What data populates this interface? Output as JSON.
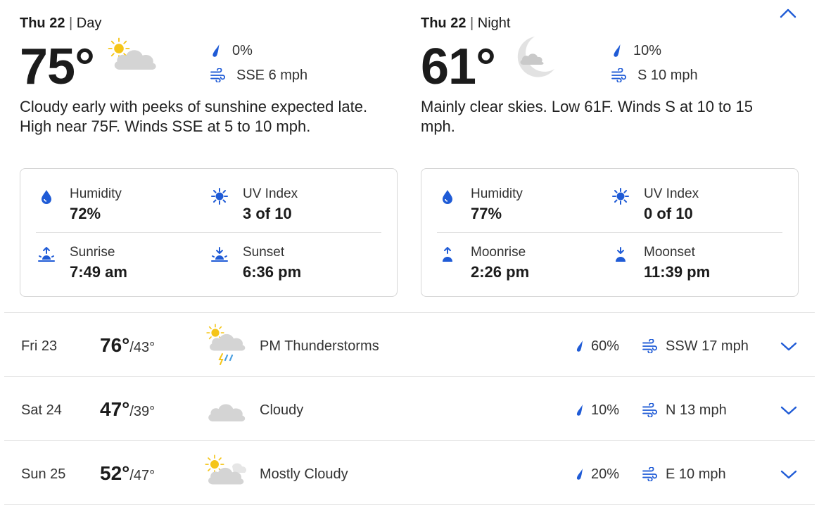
{
  "day": {
    "date": "Thu 22",
    "period": "Day",
    "temp": "75°",
    "precip": "0%",
    "wind": "SSE 6 mph",
    "description": "Cloudy early with peeks of sunshine expected late. High near 75F. Winds SSE at 5 to 10 mph.",
    "icon": "partly-cloudy-day-icon",
    "details": [
      {
        "label": "Humidity",
        "value": "72%",
        "icon": "humidity-drop-icon"
      },
      {
        "label": "UV Index",
        "value": "3 of 10",
        "icon": "uv-sun-icon"
      },
      {
        "label": "Sunrise",
        "value": "7:49 am",
        "icon": "sunrise-icon"
      },
      {
        "label": "Sunset",
        "value": "6:36 pm",
        "icon": "sunset-icon"
      }
    ]
  },
  "night": {
    "date": "Thu 22",
    "period": "Night",
    "temp": "61°",
    "precip": "10%",
    "wind": "S 10 mph",
    "description": "Mainly clear skies. Low 61F. Winds S at 10 to 15 mph.",
    "icon": "partly-cloudy-night-icon",
    "details": [
      {
        "label": "Humidity",
        "value": "77%",
        "icon": "humidity-drop-icon"
      },
      {
        "label": "UV Index",
        "value": "0 of 10",
        "icon": "uv-sun-icon"
      },
      {
        "label": "Moonrise",
        "value": "2:26 pm",
        "icon": "moonrise-icon"
      },
      {
        "label": "Moonset",
        "value": "11:39 pm",
        "icon": "moonset-icon"
      }
    ]
  },
  "forecast": [
    {
      "day": "Fri 23",
      "high": "76°",
      "low": "/43°",
      "condition": "PM Thunderstorms",
      "precip": "60%",
      "wind": "SSW 17 mph",
      "icon": "thunderstorm-icon"
    },
    {
      "day": "Sat 24",
      "high": "47°",
      "low": "/39°",
      "condition": "Cloudy",
      "precip": "10%",
      "wind": "N 13 mph",
      "icon": "cloud-icon"
    },
    {
      "day": "Sun 25",
      "high": "52°",
      "low": "/47°",
      "condition": "Mostly Cloudy",
      "precip": "20%",
      "wind": "E 10 mph",
      "icon": "mostly-cloudy-icon"
    }
  ],
  "colors": {
    "accent": "#1f5bd6",
    "text": "#1b1b1b",
    "cloud": "#d4d4d4",
    "sun": "#f5c518"
  }
}
